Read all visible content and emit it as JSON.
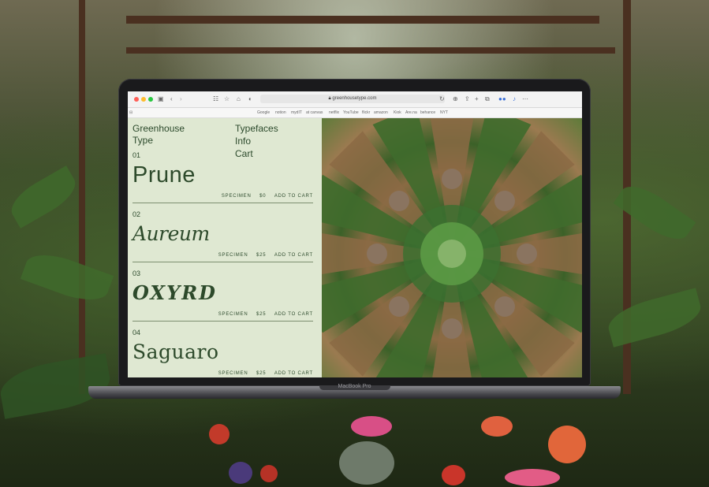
{
  "browser": {
    "url": "greenhousetype.com",
    "bookmarks": [
      "Google",
      "notion",
      "mydIT",
      "at canvas",
      "netflix",
      "YouTube",
      "flickr",
      "amazon",
      "Kiok",
      "Are.na",
      "behance",
      "NYT"
    ]
  },
  "site": {
    "brand_line1": "Greenhouse",
    "brand_line2": "Type",
    "nav": [
      "Typefaces",
      "Info",
      "Cart"
    ]
  },
  "fonts": [
    {
      "number": "01",
      "name": "Prune",
      "specimen_label": "SPECIMEN",
      "price": "$0",
      "cart_label": "ADD TO CART"
    },
    {
      "number": "02",
      "name": "Aureum",
      "specimen_label": "SPECIMEN",
      "price": "$25",
      "cart_label": "ADD TO CART"
    },
    {
      "number": "03",
      "name": "OXYRD",
      "specimen_label": "SPECIMEN",
      "price": "$25",
      "cart_label": "ADD TO CART"
    },
    {
      "number": "04",
      "name": "Saguaro",
      "specimen_label": "SPECIMEN",
      "price": "$25",
      "cart_label": "ADD TO CART"
    }
  ],
  "device": {
    "label": "MacBook Pro"
  },
  "colors": {
    "page_bg": "#dfe8d2",
    "text_green": "#2c4a2c"
  },
  "icons": [
    "sidebar-icon",
    "back-icon",
    "forward-icon",
    "grid-icon",
    "star-icon",
    "home-icon",
    "shield-icon",
    "lock-icon",
    "reload-icon",
    "share-icon",
    "new-tab-icon",
    "tabs-icon",
    "extension-icon",
    "more-icon"
  ]
}
